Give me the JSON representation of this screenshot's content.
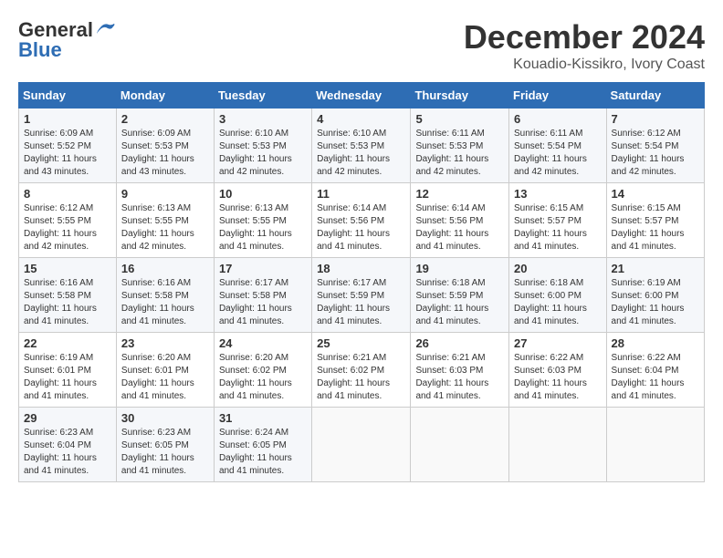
{
  "header": {
    "logo_general": "General",
    "logo_blue": "Blue",
    "month_title": "December 2024",
    "location": "Kouadio-Kissikro, Ivory Coast"
  },
  "days_of_week": [
    "Sunday",
    "Monday",
    "Tuesday",
    "Wednesday",
    "Thursday",
    "Friday",
    "Saturday"
  ],
  "weeks": [
    [
      {
        "day": "1",
        "sunrise": "6:09 AM",
        "sunset": "5:52 PM",
        "daylight": "11 hours and 43 minutes."
      },
      {
        "day": "2",
        "sunrise": "6:09 AM",
        "sunset": "5:53 PM",
        "daylight": "11 hours and 43 minutes."
      },
      {
        "day": "3",
        "sunrise": "6:10 AM",
        "sunset": "5:53 PM",
        "daylight": "11 hours and 42 minutes."
      },
      {
        "day": "4",
        "sunrise": "6:10 AM",
        "sunset": "5:53 PM",
        "daylight": "11 hours and 42 minutes."
      },
      {
        "day": "5",
        "sunrise": "6:11 AM",
        "sunset": "5:53 PM",
        "daylight": "11 hours and 42 minutes."
      },
      {
        "day": "6",
        "sunrise": "6:11 AM",
        "sunset": "5:54 PM",
        "daylight": "11 hours and 42 minutes."
      },
      {
        "day": "7",
        "sunrise": "6:12 AM",
        "sunset": "5:54 PM",
        "daylight": "11 hours and 42 minutes."
      }
    ],
    [
      {
        "day": "8",
        "sunrise": "6:12 AM",
        "sunset": "5:55 PM",
        "daylight": "11 hours and 42 minutes."
      },
      {
        "day": "9",
        "sunrise": "6:13 AM",
        "sunset": "5:55 PM",
        "daylight": "11 hours and 42 minutes."
      },
      {
        "day": "10",
        "sunrise": "6:13 AM",
        "sunset": "5:55 PM",
        "daylight": "11 hours and 41 minutes."
      },
      {
        "day": "11",
        "sunrise": "6:14 AM",
        "sunset": "5:56 PM",
        "daylight": "11 hours and 41 minutes."
      },
      {
        "day": "12",
        "sunrise": "6:14 AM",
        "sunset": "5:56 PM",
        "daylight": "11 hours and 41 minutes."
      },
      {
        "day": "13",
        "sunrise": "6:15 AM",
        "sunset": "5:57 PM",
        "daylight": "11 hours and 41 minutes."
      },
      {
        "day": "14",
        "sunrise": "6:15 AM",
        "sunset": "5:57 PM",
        "daylight": "11 hours and 41 minutes."
      }
    ],
    [
      {
        "day": "15",
        "sunrise": "6:16 AM",
        "sunset": "5:58 PM",
        "daylight": "11 hours and 41 minutes."
      },
      {
        "day": "16",
        "sunrise": "6:16 AM",
        "sunset": "5:58 PM",
        "daylight": "11 hours and 41 minutes."
      },
      {
        "day": "17",
        "sunrise": "6:17 AM",
        "sunset": "5:58 PM",
        "daylight": "11 hours and 41 minutes."
      },
      {
        "day": "18",
        "sunrise": "6:17 AM",
        "sunset": "5:59 PM",
        "daylight": "11 hours and 41 minutes."
      },
      {
        "day": "19",
        "sunrise": "6:18 AM",
        "sunset": "5:59 PM",
        "daylight": "11 hours and 41 minutes."
      },
      {
        "day": "20",
        "sunrise": "6:18 AM",
        "sunset": "6:00 PM",
        "daylight": "11 hours and 41 minutes."
      },
      {
        "day": "21",
        "sunrise": "6:19 AM",
        "sunset": "6:00 PM",
        "daylight": "11 hours and 41 minutes."
      }
    ],
    [
      {
        "day": "22",
        "sunrise": "6:19 AM",
        "sunset": "6:01 PM",
        "daylight": "11 hours and 41 minutes."
      },
      {
        "day": "23",
        "sunrise": "6:20 AM",
        "sunset": "6:01 PM",
        "daylight": "11 hours and 41 minutes."
      },
      {
        "day": "24",
        "sunrise": "6:20 AM",
        "sunset": "6:02 PM",
        "daylight": "11 hours and 41 minutes."
      },
      {
        "day": "25",
        "sunrise": "6:21 AM",
        "sunset": "6:02 PM",
        "daylight": "11 hours and 41 minutes."
      },
      {
        "day": "26",
        "sunrise": "6:21 AM",
        "sunset": "6:03 PM",
        "daylight": "11 hours and 41 minutes."
      },
      {
        "day": "27",
        "sunrise": "6:22 AM",
        "sunset": "6:03 PM",
        "daylight": "11 hours and 41 minutes."
      },
      {
        "day": "28",
        "sunrise": "6:22 AM",
        "sunset": "6:04 PM",
        "daylight": "11 hours and 41 minutes."
      }
    ],
    [
      {
        "day": "29",
        "sunrise": "6:23 AM",
        "sunset": "6:04 PM",
        "daylight": "11 hours and 41 minutes."
      },
      {
        "day": "30",
        "sunrise": "6:23 AM",
        "sunset": "6:05 PM",
        "daylight": "11 hours and 41 minutes."
      },
      {
        "day": "31",
        "sunrise": "6:24 AM",
        "sunset": "6:05 PM",
        "daylight": "11 hours and 41 minutes."
      },
      null,
      null,
      null,
      null
    ]
  ],
  "labels": {
    "sunrise": "Sunrise:",
    "sunset": "Sunset:",
    "daylight": "Daylight: "
  }
}
